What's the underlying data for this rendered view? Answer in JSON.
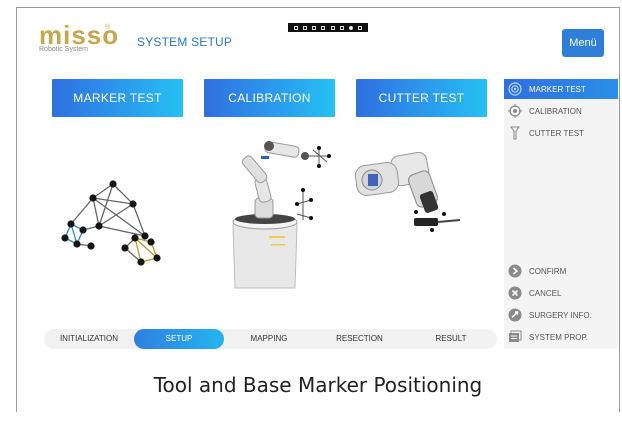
{
  "header": {
    "logo_text": "misso",
    "logo_registered": "®",
    "logo_subtitle": "Robotic System",
    "page_title": "SYSTEM SETUP",
    "menu_label": "Menü"
  },
  "mode_tabs": [
    {
      "label": "MARKER TEST"
    },
    {
      "label": "CALIBRATION"
    },
    {
      "label": "CUTTER TEST"
    }
  ],
  "right_panel": {
    "top_items": [
      {
        "label": "MARKER TEST",
        "icon": "target-icon",
        "active": true
      },
      {
        "label": "CALIBRATION",
        "icon": "crosshair-icon",
        "active": false
      },
      {
        "label": "CUTTER TEST",
        "icon": "cutter-tool-icon",
        "active": false
      }
    ],
    "bottom_items": [
      {
        "label": "CONFIRM",
        "icon": "confirm-arrow-icon"
      },
      {
        "label": "CANCEL",
        "icon": "cancel-x-icon"
      },
      {
        "label": "SURGERY INFO.",
        "icon": "info-icon"
      },
      {
        "label": "SYSTEM PROP.",
        "icon": "system-properties-icon"
      }
    ]
  },
  "steps": [
    {
      "label": "INITIALIZATION",
      "active": false
    },
    {
      "label": "SETUP",
      "active": true
    },
    {
      "label": "MAPPING",
      "active": false
    },
    {
      "label": "RESECTION",
      "active": false
    },
    {
      "label": "RESULT",
      "active": false
    }
  ],
  "caption": "Tool and Base Marker Positioning",
  "colors": {
    "accent_blue": "#2f7fd8",
    "logo_gold": "#c8a64b",
    "title_blue": "#2a78c8"
  }
}
